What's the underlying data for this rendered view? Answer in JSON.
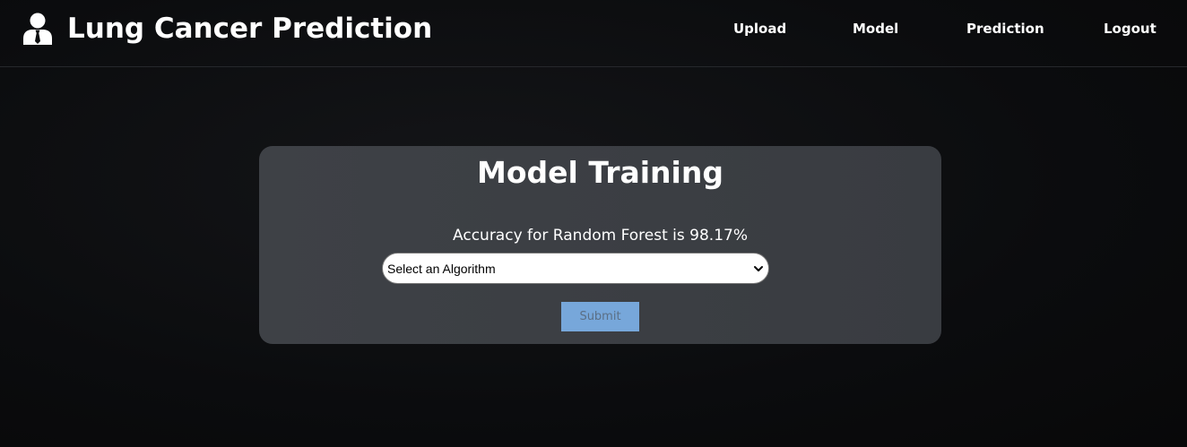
{
  "header": {
    "title": "Lung Cancer Prediction",
    "logo_icon": "user-tie-icon",
    "nav": [
      {
        "label": "Upload"
      },
      {
        "label": "Model"
      },
      {
        "label": "Prediction"
      },
      {
        "label": "Logout"
      }
    ]
  },
  "card": {
    "title": "Model Training",
    "accuracy_text": "Accuracy for Random Forest is 98.17%",
    "select": {
      "selected": "Select an Algorithm",
      "icon": "chevron-down-icon"
    },
    "submit_label": "Submit"
  },
  "colors": {
    "background": "#0d0e10",
    "card": "#3e4146",
    "submit_bg": "#77a7da",
    "submit_text": "#5b6f85"
  }
}
